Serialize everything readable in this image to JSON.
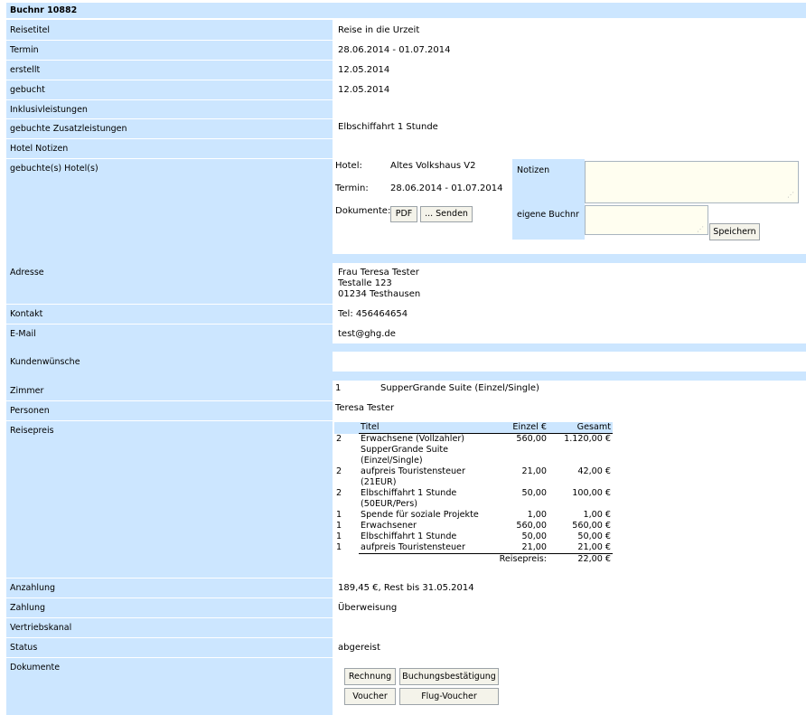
{
  "header": {
    "title": "Buchnr 10882"
  },
  "rows": {
    "reisetitel": {
      "label": "Reisetitel",
      "value": "Reise in die Urzeit"
    },
    "termin": {
      "label": "Termin",
      "value": "28.06.2014 - 01.07.2014"
    },
    "erstellt": {
      "label": "erstellt",
      "value": "12.05.2014"
    },
    "gebucht": {
      "label": "gebucht",
      "value": "12.05.2014"
    },
    "inklusiv": {
      "label": "Inklusivleistungen",
      "value": ""
    },
    "zusatz": {
      "label": "gebuchte Zusatzleistungen",
      "value": "Elbschiffahrt 1 Stunde"
    },
    "hotelnotizen": {
      "label": "Hotel Notizen",
      "value": ""
    },
    "hotels": {
      "label": "gebuchte(s) Hotel(s)"
    },
    "adresse": {
      "label": "Adresse",
      "lines": [
        "Frau Teresa Tester",
        "Testalle 123",
        "01234 Testhausen"
      ]
    },
    "kontakt": {
      "label": "Kontakt",
      "value": "Tel: 456464654"
    },
    "email": {
      "label": "E-Mail",
      "value": "test@ghg.de"
    },
    "kundenwuensche": {
      "label": "Kundenwünsche",
      "value": ""
    },
    "zimmer": {
      "label": "Zimmer",
      "qty": "1",
      "value": "SupperGrande Suite (Einzel/Single)"
    },
    "personen": {
      "label": "Personen",
      "value": "Teresa Tester"
    },
    "reisepreis": {
      "label": "Reisepreis"
    },
    "anzahlung": {
      "label": "Anzahlung",
      "value": "189,45 €, Rest bis 31.05.2014"
    },
    "zahlung": {
      "label": "Zahlung",
      "value": "Überweisung"
    },
    "vertrieb": {
      "label": "Vertriebskanal",
      "value": ""
    },
    "status": {
      "label": "Status",
      "value": "abgereist"
    },
    "dokumente": {
      "label": "Dokumente"
    }
  },
  "hotel": {
    "hotel_label": "Hotel:",
    "hotel_value": "Altes Volkshaus V2",
    "termin_label": "Termin:",
    "termin_value": "28.06.2014 - 01.07.2014",
    "dok_label": "Dokumente:",
    "pdf_button": "PDF",
    "send_button": "... Senden",
    "notizen_label": "Notizen",
    "notizen_value": "",
    "buchnr_label": "eigene Buchnr",
    "buchnr_value": "",
    "save_button": "Speichern"
  },
  "price_table": {
    "headers": {
      "qty": "",
      "title": "Titel",
      "single": "Einzel €",
      "total": "Gesamt"
    },
    "items": [
      {
        "qty": "2",
        "title": "Erwachsene (Vollzahler) SupperGrande Suite (Einzel/Single)",
        "single": "560,00",
        "total": "1.120,00 €"
      },
      {
        "qty": "2",
        "title": "aufpreis Touristensteuer (21EUR)",
        "single": "21,00",
        "total": "42,00 €"
      },
      {
        "qty": "2",
        "title": "Elbschiffahrt 1 Stunde (50EUR/Pers)",
        "single": "50,00",
        "total": "100,00 €"
      },
      {
        "qty": "1",
        "title": "Spende für soziale Projekte",
        "single": "1,00",
        "total": "1,00 €"
      },
      {
        "qty": "1",
        "title": "Erwachsener",
        "single": "560,00",
        "total": "560,00 €"
      },
      {
        "qty": "1",
        "title": "Elbschiffahrt 1 Stunde",
        "single": "50,00",
        "total": "50,00 €"
      },
      {
        "qty": "1",
        "title": "aufpreis Touristensteuer",
        "single": "21,00",
        "total": "21,00 €"
      }
    ],
    "total_label": "Reisepreis:",
    "total_value": "22,00 €"
  },
  "documents": {
    "rechnung": "Rechnung",
    "buchungsbestaetigung": "Buchungsbestätigung",
    "voucher": "Voucher",
    "flug_voucher": "Flug-Voucher"
  },
  "colors": {
    "label_bg": "#cce6ff",
    "input_bg": "#fffef0"
  }
}
